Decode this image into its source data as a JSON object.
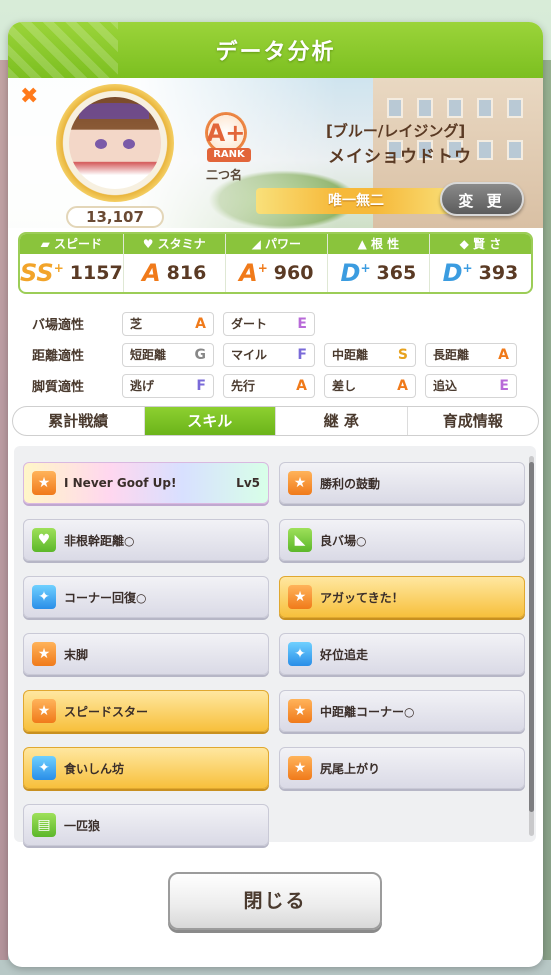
{
  "dialog": {
    "title": "データ分析",
    "close_label": "閉じる"
  },
  "profile": {
    "fans": "13,107",
    "rank_letter": "A+",
    "rank_label": "RANK",
    "nickname_count": "二つ名",
    "epithet": "[ブルー/レイジング]",
    "name": "メイショウドトウ",
    "title": "唯一無二",
    "change_label": "変 更"
  },
  "stats": [
    {
      "label": "スピード",
      "icon": "shoe-icon",
      "grade": "SS",
      "plus": "+",
      "value": "1157"
    },
    {
      "label": "スタミナ",
      "icon": "heart-icon",
      "grade": "A",
      "plus": "",
      "value": "816"
    },
    {
      "label": "パワー",
      "icon": "muscle-icon",
      "grade": "A",
      "plus": "+",
      "value": "960"
    },
    {
      "label": "根 性",
      "icon": "flame-icon",
      "grade": "D",
      "plus": "+",
      "value": "365"
    },
    {
      "label": "賢 さ",
      "icon": "cap-icon",
      "grade": "D",
      "plus": "+",
      "value": "393"
    }
  ],
  "aptitude": {
    "track": {
      "label": "バ場適性",
      "items": [
        {
          "name": "芝",
          "grade": "A"
        },
        {
          "name": "ダート",
          "grade": "E"
        }
      ]
    },
    "distance": {
      "label": "距離適性",
      "items": [
        {
          "name": "短距離",
          "grade": "G"
        },
        {
          "name": "マイル",
          "grade": "F"
        },
        {
          "name": "中距離",
          "grade": "S"
        },
        {
          "name": "長距離",
          "grade": "A"
        }
      ]
    },
    "style": {
      "label": "脚質適性",
      "items": [
        {
          "name": "逃げ",
          "grade": "F"
        },
        {
          "name": "先行",
          "grade": "A"
        },
        {
          "name": "差し",
          "grade": "A"
        },
        {
          "name": "追込",
          "grade": "E"
        }
      ]
    }
  },
  "tabs": [
    "累計戦績",
    "スキル",
    "継 承",
    "育成情報"
  ],
  "skills": [
    {
      "name": "I Never Goof Up!",
      "lv": "Lv5",
      "icon": "speed-icon",
      "style": "rainbow"
    },
    {
      "name": "勝利の鼓動",
      "lv": "",
      "icon": "speed-icon",
      "style": "normal"
    },
    {
      "name": "非根幹距離○",
      "lv": "",
      "icon": "stamina-icon",
      "style": "normal"
    },
    {
      "name": "良バ場○",
      "lv": "",
      "icon": "ground-icon",
      "style": "normal"
    },
    {
      "name": "コーナー回復○",
      "lv": "",
      "icon": "recover-icon",
      "style": "normal"
    },
    {
      "name": "アガッてきた！",
      "lv": "",
      "icon": "speed-icon",
      "style": "gold"
    },
    {
      "name": "末脚",
      "lv": "",
      "icon": "speed-icon",
      "style": "normal"
    },
    {
      "name": "好位追走",
      "lv": "",
      "icon": "recover-icon",
      "style": "normal"
    },
    {
      "name": "スピードスター",
      "lv": "",
      "icon": "speed-icon",
      "style": "gold"
    },
    {
      "name": "中距離コーナー○",
      "lv": "",
      "icon": "speed-icon",
      "style": "normal"
    },
    {
      "name": "食いしん坊",
      "lv": "",
      "icon": "recover-icon",
      "style": "gold"
    },
    {
      "name": "尻尾上がり",
      "lv": "",
      "icon": "speed-icon",
      "style": "normal"
    },
    {
      "name": "一匹狼",
      "lv": "",
      "icon": "debuff-icon",
      "style": "normal"
    }
  ]
}
